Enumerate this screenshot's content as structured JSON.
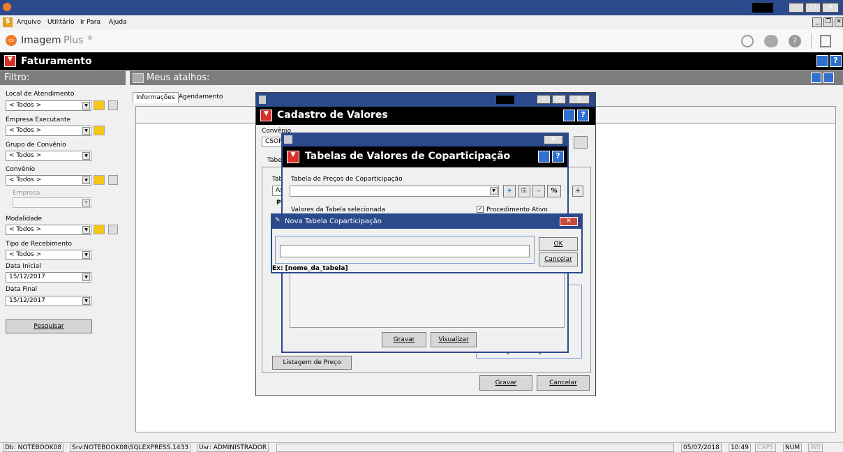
{
  "app": {
    "logo_text": "Imagem",
    "logo_plus": "Plus",
    "logo_reg": "®"
  },
  "menu": [
    "Arquivo",
    "Utilitário",
    "Ir Para",
    "Ajuda"
  ],
  "module_title": "Faturamento",
  "filter": {
    "title": "Filtro:",
    "local_label": "Local de Atendimento",
    "local_value": "< Todos >",
    "empresa_label": "Empresa Executante",
    "empresa_value": "< Todos >",
    "grupo_label": "Grupo de Convênio",
    "grupo_value": "< Todos >",
    "convenio_label": "Convênio",
    "convenio_value": "< Todos >",
    "empresa_sub_label": "Empresa",
    "modalidade_label": "Modalidade",
    "modalidade_value": "< Todos >",
    "tipo_label": "Tipo de Recebimento",
    "tipo_value": "< Todos >",
    "data_ini_label": "Data Inicial",
    "data_ini_value": "15/12/2017",
    "data_fim_label": "Data Final",
    "data_fim_value": "15/12/2017",
    "search_label": "Pesquisar"
  },
  "shortcuts": {
    "title": "Meus atalhos:"
  },
  "tabs": [
    "Informações",
    "Agendamento"
  ],
  "cadastro": {
    "title": "Cadastro de Valores",
    "convenio_label": "Convênio",
    "convenio_value": "CSOR",
    "tab_partial": "Tabe",
    "tab_partial2": "Tab",
    "as_partial": "As",
    "p_partial": "P",
    "listagem": "Listagem de Preço",
    "gravar": "Gravar",
    "cancelar": "Cancelar",
    "registro": "Registro Cong",
    "proc_ativo": "Procedimento Ativo"
  },
  "tabelas": {
    "title": "Tabelas de Valores de Coparticipação",
    "preco_label": "Tabela de Preços de Coparticipação",
    "valores_label": "Valores da Tabela selecionada",
    "gravar": "Gravar",
    "visualizar": "Visualizar"
  },
  "nova": {
    "title": "Nova Tabela Coparticipação",
    "input_value": "",
    "hint": "Ex: [nome_da_tabela]",
    "ok": "OK",
    "cancel": "Cancelar"
  },
  "status": {
    "db": "Db: NOTEBOOK08",
    "srv": "Srv:NOTEBOOK08\\SQLEXPRESS.1433",
    "usr": "Usr: ADMINISTRADOR",
    "date": "05/07/2018",
    "time": "10:49",
    "caps": "CAPS",
    "num": "NUM",
    "ins": "INS"
  },
  "colors": {
    "titlebar": "#2e4a8a",
    "accent": "#d9302b",
    "link": "#1060c0"
  }
}
